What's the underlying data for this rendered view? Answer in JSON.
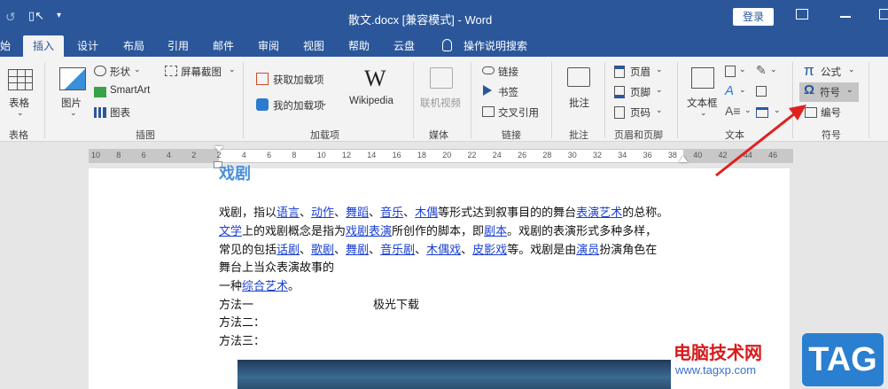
{
  "title_bar": {
    "title": "散文.docx [兼容模式] - Word",
    "login": "登录"
  },
  "tabs": [
    "始",
    "插入",
    "设计",
    "布局",
    "引用",
    "邮件",
    "审阅",
    "视图",
    "帮助",
    "云盘",
    "操作说明搜索"
  ],
  "ribbon": {
    "tables": {
      "btn": "表格",
      "group": "表格"
    },
    "illustrations": {
      "picture": "图片",
      "shapes": "形状",
      "smartart": "SmartArt",
      "chart": "图表",
      "screenshot": "屏幕截图",
      "group": "插图"
    },
    "addins": {
      "get": "获取加载项",
      "my": "我的加载项",
      "wikipedia": "Wikipedia",
      "group": "加载项"
    },
    "media": {
      "online_video": "联机视频",
      "group": "媒体"
    },
    "links": {
      "link": "链接",
      "bookmark": "书签",
      "cross_ref": "交叉引用",
      "group": "链接"
    },
    "comments": {
      "comment": "批注",
      "group": "批注"
    },
    "header_footer": {
      "header": "页眉",
      "footer": "页脚",
      "page_number": "页码",
      "group": "页眉和页脚"
    },
    "text": {
      "textbox": "文本框",
      "group": "文本"
    },
    "symbols": {
      "equation": "公式",
      "symbol": "符号",
      "numbering": "编号",
      "group": "符号",
      "pi_glyph": "π",
      "omega_glyph": "Ω"
    }
  },
  "ruler": [
    "10",
    "8",
    "6",
    "4",
    "2",
    "2",
    "4",
    "6",
    "8",
    "10",
    "12",
    "14",
    "16",
    "18",
    "20",
    "22",
    "24",
    "26",
    "28",
    "30",
    "32",
    "34",
    "36",
    "38",
    "40",
    "42",
    "44",
    "46"
  ],
  "document": {
    "heading": "戏剧",
    "p1": [
      {
        "t": "戏剧，指以",
        "l": false
      },
      {
        "t": "语言",
        "l": true
      },
      {
        "t": "、",
        "l": false
      },
      {
        "t": "动作",
        "l": true
      },
      {
        "t": "、",
        "l": false
      },
      {
        "t": "舞蹈",
        "l": true
      },
      {
        "t": "、",
        "l": false
      },
      {
        "t": "音乐",
        "l": true
      },
      {
        "t": "、",
        "l": false
      },
      {
        "t": "木偶",
        "l": true
      },
      {
        "t": "等形式达到叙事目的的舞台",
        "l": false
      },
      {
        "t": "表演艺术",
        "l": true
      },
      {
        "t": "的总称。",
        "l": false
      }
    ],
    "p2": [
      {
        "t": "文学",
        "l": true
      },
      {
        "t": "上的戏剧概念是指为",
        "l": false
      },
      {
        "t": "戏剧表演",
        "l": true
      },
      {
        "t": "所创作的脚本，即",
        "l": false
      },
      {
        "t": "剧本",
        "l": true
      },
      {
        "t": "。戏剧的表演形式多种多样，",
        "l": false
      }
    ],
    "p3": [
      {
        "t": "常见的包括",
        "l": false
      },
      {
        "t": "话剧",
        "l": true
      },
      {
        "t": "、",
        "l": false
      },
      {
        "t": "歌剧",
        "l": true
      },
      {
        "t": "、",
        "l": false
      },
      {
        "t": "舞剧",
        "l": true
      },
      {
        "t": "、",
        "l": false
      },
      {
        "t": "音乐剧",
        "l": true
      },
      {
        "t": "、",
        "l": false
      },
      {
        "t": "木偶戏",
        "l": true
      },
      {
        "t": "、",
        "l": false
      },
      {
        "t": "皮影戏",
        "l": true
      },
      {
        "t": "等。戏剧是由",
        "l": false
      },
      {
        "t": "演员",
        "l": true
      },
      {
        "t": "扮演角色在",
        "l": false
      }
    ],
    "p4": "舞台上当众表演故事的",
    "p5": [
      {
        "t": "一种",
        "l": false
      },
      {
        "t": "综合艺术",
        "l": true
      },
      {
        "t": "。",
        "l": false
      }
    ],
    "m1": "方法一",
    "m1b": "极光下载",
    "m2": "方法二：",
    "m3": "方法三："
  },
  "watermark": {
    "site": "电脑技术网",
    "url": "www.tagxp.com",
    "tag": "TAG"
  }
}
